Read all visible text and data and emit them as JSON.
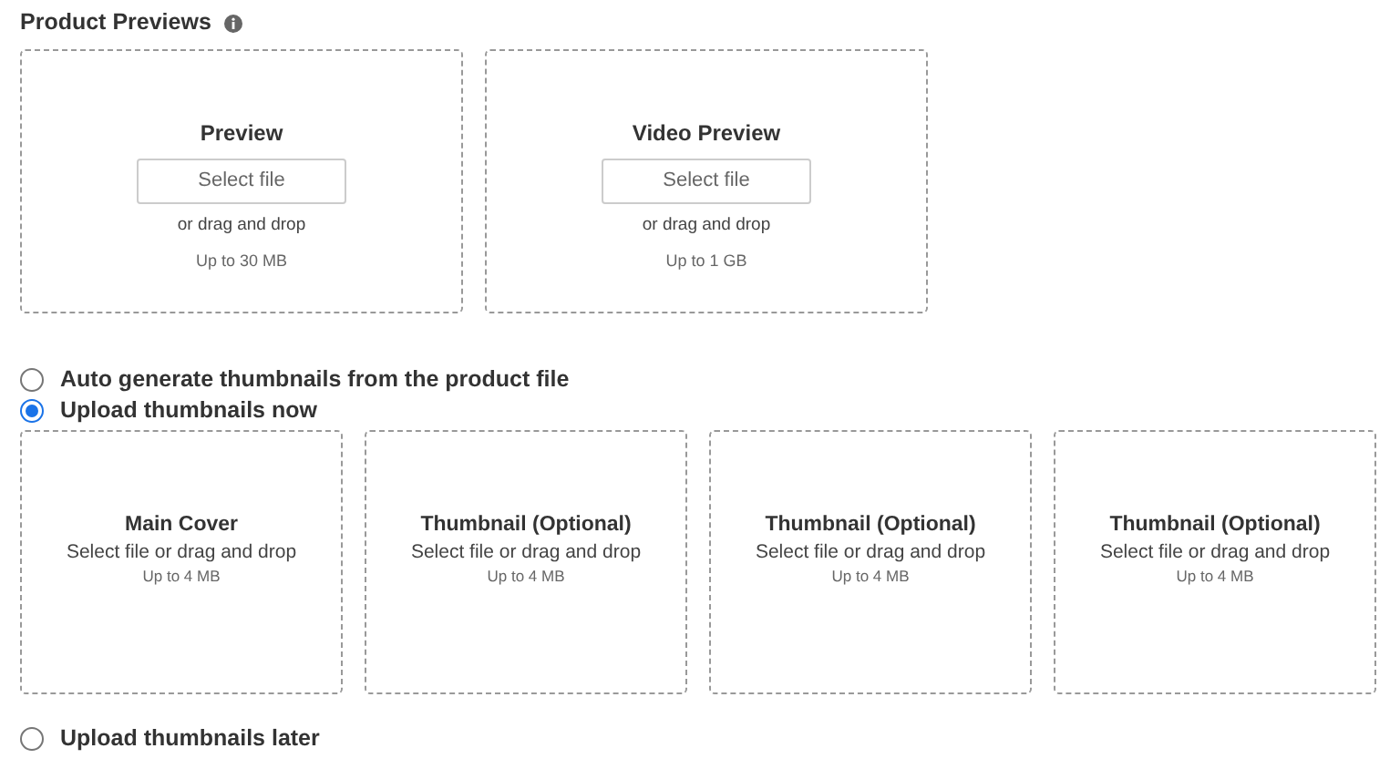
{
  "section": {
    "title": "Product Previews"
  },
  "previews": [
    {
      "title": "Preview",
      "button": "Select file",
      "hint": "or drag and drop",
      "limit": "Up to 30 MB"
    },
    {
      "title": "Video Preview",
      "button": "Select file",
      "hint": "or drag and drop",
      "limit": "Up to 1 GB"
    }
  ],
  "thumbnail_options": [
    {
      "label": "Auto generate thumbnails from the product file",
      "selected": false
    },
    {
      "label": "Upload thumbnails now",
      "selected": true
    },
    {
      "label": "Upload thumbnails later",
      "selected": false
    }
  ],
  "thumbnails": [
    {
      "title": "Main Cover",
      "hint": "Select file or drag and drop",
      "limit": "Up to 4 MB"
    },
    {
      "title": "Thumbnail (Optional)",
      "hint": "Select file or drag and drop",
      "limit": "Up to 4 MB"
    },
    {
      "title": "Thumbnail (Optional)",
      "hint": "Select file or drag and drop",
      "limit": "Up to 4 MB"
    },
    {
      "title": "Thumbnail (Optional)",
      "hint": "Select file or drag and drop",
      "limit": "Up to 4 MB"
    }
  ]
}
